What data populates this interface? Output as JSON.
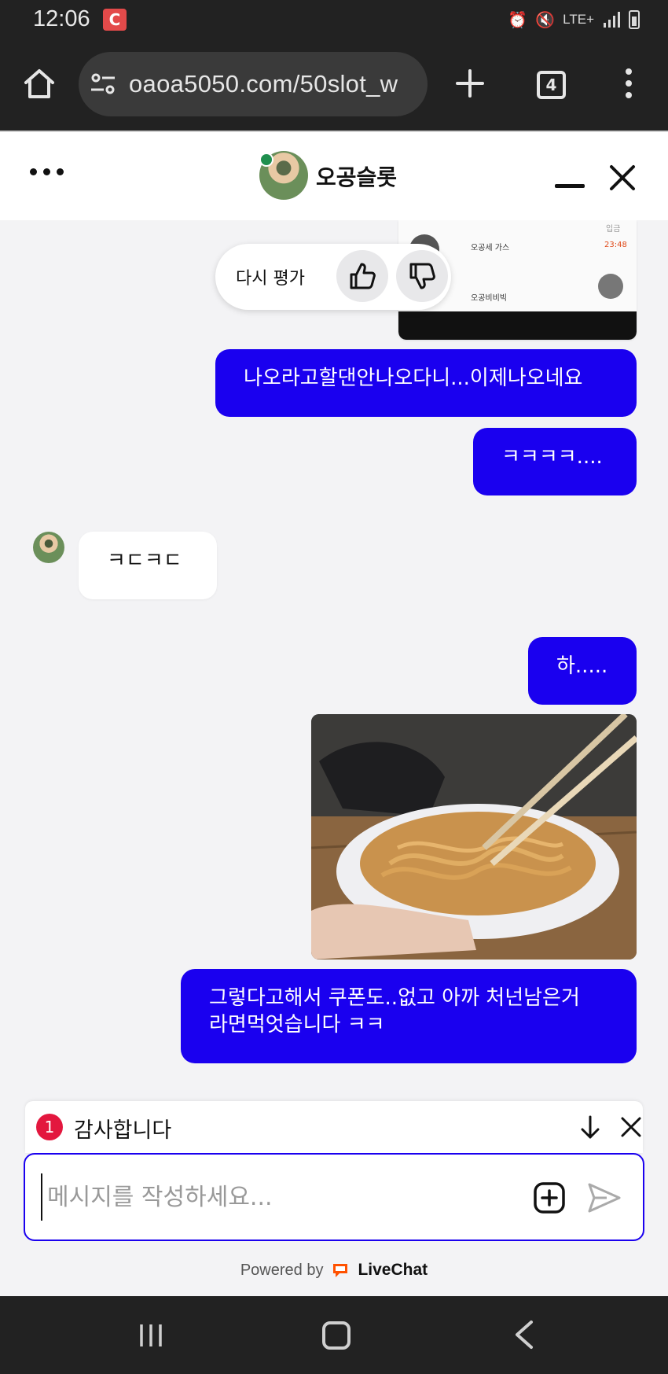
{
  "status_bar": {
    "time": "12:06",
    "app_icon_glyph": "C",
    "network": "LTE+",
    "icons": [
      "alarm-icon",
      "mute-icon",
      "signal-icon",
      "battery-icon"
    ]
  },
  "browser": {
    "url": "oaoa5050.com/50slot_w",
    "tab_count": "4",
    "icons": [
      "home-icon",
      "site-settings-icon",
      "new-tab-icon",
      "tabs-icon",
      "menu-icon"
    ]
  },
  "chat_header": {
    "agent_name": "오공슬롯",
    "agent_status_color": "#1f8f4e"
  },
  "rating": {
    "label": "다시 평가"
  },
  "prev_screenshot": {
    "row1": "오공세 가스",
    "row1_time": "23:48",
    "row2": "오공비비빅",
    "top_label": "입금"
  },
  "messages": [
    {
      "side": "out",
      "text": "나오라고할댄안나오다니...이제나오네요"
    },
    {
      "side": "out",
      "text": "ㅋㅋㅋㅋ...."
    },
    {
      "side": "in",
      "text": "ㅋㄷㅋㄷ"
    },
    {
      "side": "out",
      "text": "하....."
    },
    {
      "side": "out",
      "type": "image",
      "description_alt": "ramen"
    },
    {
      "side": "out",
      "text_line1": "그렇다고해서 쿠폰도..없고 아까 처넌남은거",
      "text_line2": "라면먹엇습니다 ㅋㅋ"
    }
  ],
  "notification": {
    "count": "1",
    "text": "감사합니다"
  },
  "composer": {
    "placeholder": "메시지를 작성하세요..."
  },
  "footer": {
    "powered_by": "Powered by",
    "brand": "LiveChat",
    "brand_color": "#ff5100"
  },
  "colors": {
    "outgoing_bubble": "#1a00ef",
    "incoming_bubble": "#ffffff",
    "chat_bg": "#f3f3f5"
  }
}
